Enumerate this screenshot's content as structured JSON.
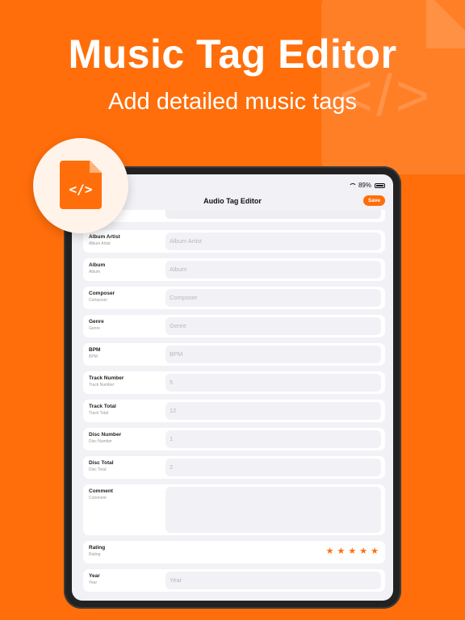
{
  "hero": {
    "title": "Music Tag Editor",
    "subtitle": "Add detailed music tags",
    "bg_code_glyph": "</>",
    "badge_code_glyph": "</>"
  },
  "status_bar": {
    "battery": "89%"
  },
  "navbar": {
    "title": "Audio Tag Editor",
    "save_label": "Save"
  },
  "fields": [
    {
      "label": "Album Artist",
      "sublabel": "Album Artist",
      "value": "Album Artist",
      "kind": "placeholder"
    },
    {
      "label": "Album",
      "sublabel": "Album",
      "value": "Album",
      "kind": "placeholder"
    },
    {
      "label": "Composer",
      "sublabel": "Composer",
      "value": "Composer",
      "kind": "placeholder"
    },
    {
      "label": "Genre",
      "sublabel": "Genre",
      "value": "Genre",
      "kind": "placeholder"
    },
    {
      "label": "BPM",
      "sublabel": "BPM",
      "value": "BPM",
      "kind": "placeholder"
    },
    {
      "label": "Track Number",
      "sublabel": "Track Number",
      "value": "5",
      "kind": "placeholder"
    },
    {
      "label": "Track Total",
      "sublabel": "Track Total",
      "value": "12",
      "kind": "placeholder"
    },
    {
      "label": "Disc Number",
      "sublabel": "Disc Number",
      "value": "1",
      "kind": "placeholder"
    },
    {
      "label": "Disc Total",
      "sublabel": "Disc Total",
      "value": "2",
      "kind": "placeholder"
    }
  ],
  "comment": {
    "label": "Comment",
    "sublabel": "Comment"
  },
  "rating": {
    "label": "Rating",
    "sublabel": "Rating",
    "stars": 5,
    "star_glyph": "★"
  },
  "year": {
    "label": "Year",
    "sublabel": "Year",
    "value": "Year"
  },
  "colors": {
    "accent": "#FF6E0A",
    "screen_bg": "#F2F2F6"
  },
  "icons": [
    "wifi-icon",
    "battery-icon",
    "file-code-icon",
    "star-icon"
  ]
}
